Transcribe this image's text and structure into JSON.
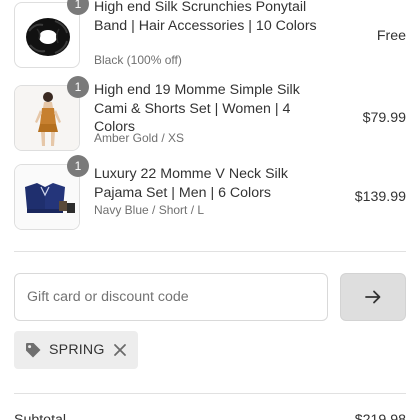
{
  "items": [
    {
      "quantity": "1",
      "title": "High end Silk Scrunchies Ponytail Band | Hair Accessories | 10 Colors",
      "variant": "Black (100% off)",
      "price": "Free",
      "thumbnail": "black-scrunchie-image"
    },
    {
      "quantity": "1",
      "title": "High end 19 Momme Simple Silk Cami & Shorts Set | Women | 4 Colors",
      "variant": "Amber Gold / XS",
      "price": "$79.99",
      "thumbnail": "amber-silk-cami-set-image"
    },
    {
      "quantity": "1",
      "title": "Luxury 22 Momme V Neck Silk Pajama Set | Men | 6 Colors",
      "variant": "Navy Blue / Short / L",
      "price": "$139.99",
      "thumbnail": "navy-silk-pajama-set-image"
    }
  ],
  "discount": {
    "placeholder": "Gift card or discount code",
    "value": "",
    "apply_icon": "arrow-right-icon"
  },
  "applied_codes": [
    {
      "label": "SPRING",
      "icon": "tag-icon",
      "remove_icon": "close-icon"
    }
  ],
  "summary": {
    "subtotal_label": "Subtotal",
    "subtotal_value": "$219.98"
  },
  "colors": {
    "badge": "#7a7a7a",
    "text": "#333333",
    "muted": "#707070",
    "button_bg": "#dedede",
    "tag_bg": "#ededed"
  }
}
